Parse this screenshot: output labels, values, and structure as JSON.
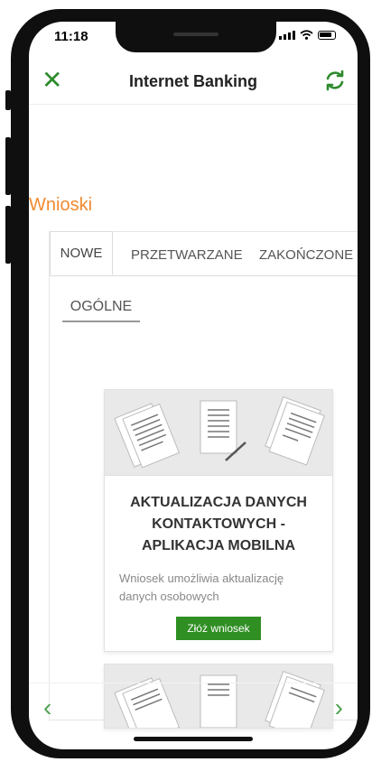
{
  "status_bar": {
    "time": "11:18"
  },
  "header": {
    "title": "Internet Banking",
    "close_icon": "close-icon",
    "refresh_icon": "refresh-icon",
    "accent": "#2e8b2e"
  },
  "section": {
    "title": "Wnioski",
    "color": "#f08a30"
  },
  "tabs": [
    {
      "label": "NOWE"
    },
    {
      "label": "PRZETWARZANE"
    },
    {
      "label": "ZAKOŃCZONE"
    }
  ],
  "subtab": {
    "label": "OGÓLNE"
  },
  "products": [
    {
      "title": "AKTUALIZACJA DANYCH KONTAKTOWYCH - APLIKACJA MOBILNA",
      "description": "Wniosek umożliwia aktualizację danych osobowych",
      "button": "Złóż wniosek",
      "button_color": "#2f8f23"
    }
  ],
  "nav": {
    "prev_icon": "chevron-left-icon",
    "next_icon": "chevron-right-icon"
  }
}
